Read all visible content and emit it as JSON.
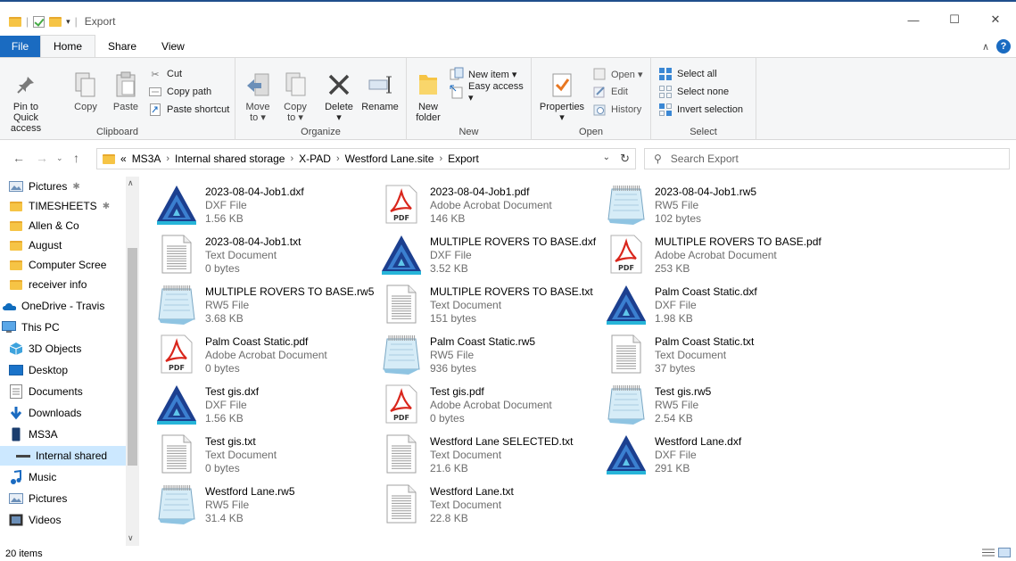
{
  "window": {
    "title": "Export",
    "controls": [
      "—",
      "☐",
      "✕"
    ]
  },
  "ribbon": {
    "tabs": [
      {
        "key": "file",
        "label": "File"
      },
      {
        "key": "home",
        "label": "Home"
      },
      {
        "key": "share",
        "label": "Share"
      },
      {
        "key": "view",
        "label": "View"
      }
    ],
    "clipboard": {
      "label": "Clipboard",
      "pin": "Pin to Quick\naccess",
      "copy": "Copy",
      "paste": "Paste",
      "cut": "Cut",
      "copy_path": "Copy path",
      "paste_shortcut": "Paste shortcut"
    },
    "organize": {
      "label": "Organize",
      "move_to": "Move\nto ▾",
      "copy_to": "Copy\nto ▾",
      "delete": "Delete\n▾",
      "rename": "Rename"
    },
    "new": {
      "label": "New",
      "new_folder": "New\nfolder",
      "new_item": "New item ▾",
      "easy_access": "Easy access ▾"
    },
    "open": {
      "label": "Open",
      "properties": "Properties\n▾",
      "open": "Open ▾",
      "edit": "Edit",
      "history": "History"
    },
    "select": {
      "label": "Select",
      "select_all": "Select all",
      "select_none": "Select none",
      "invert": "Invert selection"
    }
  },
  "address": {
    "prefix": "«",
    "crumbs": [
      "MS3A",
      "Internal shared storage",
      "X-PAD",
      "Westford Lane.site",
      "Export"
    ],
    "search_placeholder": "Search Export"
  },
  "sidebar": {
    "items": [
      {
        "label": "Pictures",
        "icon": "pictures-icon",
        "pinned": true,
        "indent": 1
      },
      {
        "label": "TIMESHEETS",
        "icon": "folder-icon",
        "pinned": true,
        "indent": 1
      },
      {
        "label": "Allen & Co",
        "icon": "folder-icon",
        "indent": 1
      },
      {
        "label": "August",
        "icon": "folder-icon",
        "indent": 1
      },
      {
        "label": "Computer Scree",
        "icon": "folder-icon",
        "indent": 1
      },
      {
        "label": "receiver info",
        "icon": "folder-icon",
        "indent": 1
      },
      {
        "label": "OneDrive - Travis",
        "icon": "onedrive-icon",
        "indent": 0
      },
      {
        "label": "This PC",
        "icon": "pc-icon",
        "indent": 0
      },
      {
        "label": "3D Objects",
        "icon": "3d-objects-icon",
        "indent": 1
      },
      {
        "label": "Desktop",
        "icon": "desktop-icon",
        "indent": 1
      },
      {
        "label": "Documents",
        "icon": "documents-icon",
        "indent": 1
      },
      {
        "label": "Downloads",
        "icon": "downloads-icon",
        "indent": 1
      },
      {
        "label": "MS3A",
        "icon": "device-icon",
        "indent": 1
      },
      {
        "label": "Internal shared",
        "icon": "storage-icon",
        "indent": 2,
        "selected": true
      },
      {
        "label": "Music",
        "icon": "music-icon",
        "indent": 1
      },
      {
        "label": "Pictures",
        "icon": "pictures-icon",
        "indent": 1
      },
      {
        "label": "Videos",
        "icon": "videos-icon",
        "indent": 1
      }
    ]
  },
  "files": [
    {
      "name": "2023-08-04-Job1.dxf",
      "type": "DXF File",
      "size": "1.56 KB",
      "icon": "dxf"
    },
    {
      "name": "2023-08-04-Job1.pdf",
      "type": "Adobe Acrobat Document",
      "size": "146 KB",
      "icon": "pdf"
    },
    {
      "name": "2023-08-04-Job1.rw5",
      "type": "RW5 File",
      "size": "102 bytes",
      "icon": "rw5"
    },
    {
      "name": "2023-08-04-Job1.txt",
      "type": "Text Document",
      "size": "0 bytes",
      "icon": "txt"
    },
    {
      "name": "MULTIPLE ROVERS TO BASE.dxf",
      "type": "DXF File",
      "size": "3.52 KB",
      "icon": "dxf"
    },
    {
      "name": "MULTIPLE ROVERS TO BASE.pdf",
      "type": "Adobe Acrobat Document",
      "size": "253 KB",
      "icon": "pdf"
    },
    {
      "name": "MULTIPLE ROVERS TO BASE.rw5",
      "type": "RW5 File",
      "size": "3.68 KB",
      "icon": "rw5"
    },
    {
      "name": "MULTIPLE ROVERS TO BASE.txt",
      "type": "Text Document",
      "size": "151 bytes",
      "icon": "txt"
    },
    {
      "name": "Palm Coast Static.dxf",
      "type": "DXF File",
      "size": "1.98 KB",
      "icon": "dxf"
    },
    {
      "name": "Palm Coast Static.pdf",
      "type": "Adobe Acrobat Document",
      "size": "0 bytes",
      "icon": "pdf"
    },
    {
      "name": "Palm Coast Static.rw5",
      "type": "RW5 File",
      "size": "936 bytes",
      "icon": "rw5"
    },
    {
      "name": "Palm Coast Static.txt",
      "type": "Text Document",
      "size": "37 bytes",
      "icon": "txt"
    },
    {
      "name": "Test gis.dxf",
      "type": "DXF File",
      "size": "1.56 KB",
      "icon": "dxf"
    },
    {
      "name": "Test gis.pdf",
      "type": "Adobe Acrobat Document",
      "size": "0 bytes",
      "icon": "pdf"
    },
    {
      "name": "Test gis.rw5",
      "type": "RW5 File",
      "size": "2.54 KB",
      "icon": "rw5"
    },
    {
      "name": "Test gis.txt",
      "type": "Text Document",
      "size": "0 bytes",
      "icon": "txt"
    },
    {
      "name": "Westford Lane SELECTED.txt",
      "type": "Text Document",
      "size": "21.6 KB",
      "icon": "txt"
    },
    {
      "name": "Westford Lane.dxf",
      "type": "DXF File",
      "size": "291 KB",
      "icon": "dxf"
    },
    {
      "name": "Westford Lane.rw5",
      "type": "RW5 File",
      "size": "31.4 KB",
      "icon": "rw5"
    },
    {
      "name": "Westford Lane.txt",
      "type": "Text Document",
      "size": "22.8 KB",
      "icon": "txt"
    }
  ],
  "status": {
    "item_count": "20 items"
  },
  "colors": {
    "accent": "#1a6bc1",
    "selection": "#cce8ff",
    "pdf_red": "#d9261c",
    "folder_yellow": "#f6c445"
  }
}
